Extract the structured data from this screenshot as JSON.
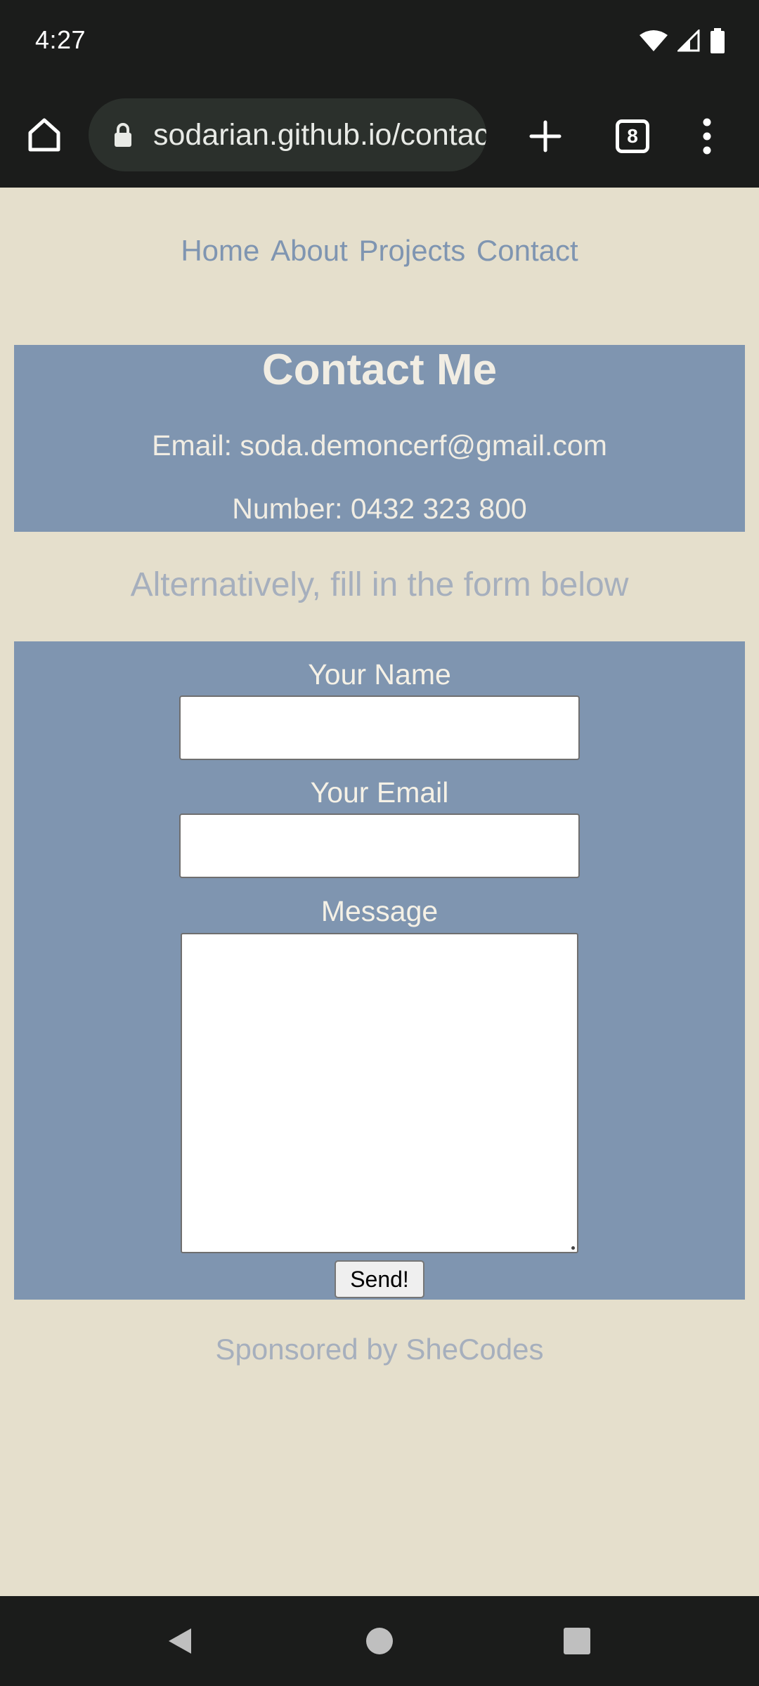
{
  "status_bar": {
    "time": "4:27",
    "icons": [
      "wifi-icon",
      "signal-icon",
      "battery-icon"
    ]
  },
  "browser": {
    "url": "sodarian.github.io/contact",
    "tab_count": "8",
    "icons": [
      "home-icon",
      "lock-icon",
      "plus-icon",
      "tabs-icon",
      "menu-dots-icon"
    ]
  },
  "nav": {
    "items": [
      "Home",
      "About",
      "Projects",
      "Contact"
    ]
  },
  "contact": {
    "title": "Contact Me",
    "email": "Email: soda.demoncerf@gmail.com",
    "number": "Number: 0432 323 800"
  },
  "alt_text": "Alternatively, fill in the form below",
  "form": {
    "name_label": "Your Name",
    "name_value": "",
    "email_label": "Your Email",
    "email_value": "",
    "message_label": "Message",
    "message_value": "",
    "send_label": "Send!"
  },
  "footer": "Sponsored by SheCodes",
  "colors": {
    "page_background": "#e5dfcc",
    "panel": "#7f95b0",
    "nav_link": "#7f95b1",
    "muted_text": "#a6afbd",
    "chrome": "#1b1c1b"
  },
  "system_nav": [
    "back-icon",
    "home-circle-icon",
    "recents-icon"
  ]
}
